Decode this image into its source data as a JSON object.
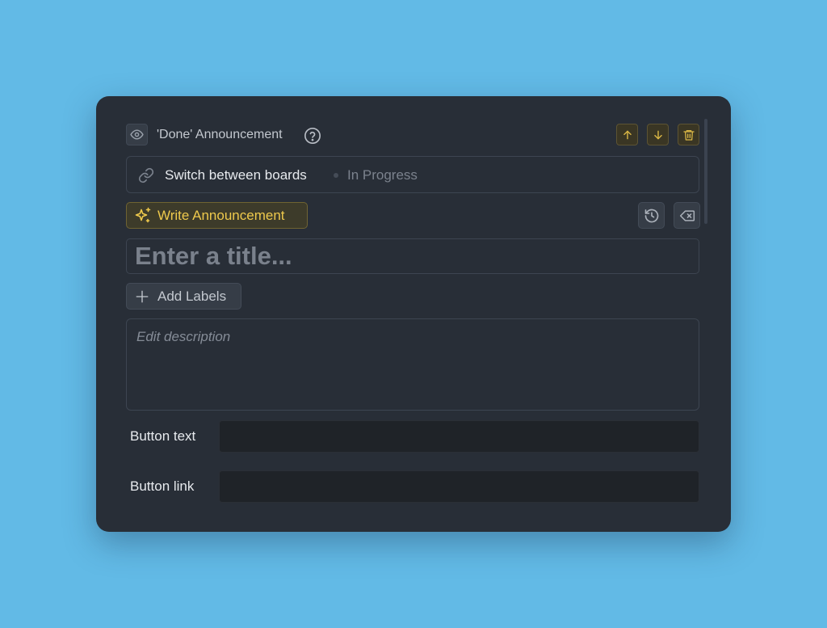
{
  "header": {
    "title": "'Done' Announcement",
    "icons": {
      "visibility": "eye-icon",
      "help": "question-circle-icon",
      "move_up": "arrow-up-icon",
      "move_down": "arrow-down-icon",
      "delete": "trash-icon"
    }
  },
  "linked_item": {
    "icon": "link-icon",
    "title": "Switch between boards",
    "status": "In Progress"
  },
  "toolbar": {
    "write_label": "Write Announcement",
    "write_icon": "sparkles-icon",
    "history_icon": "history-icon",
    "clear_icon": "backspace-icon"
  },
  "title_field": {
    "value": "",
    "placeholder": "Enter a title..."
  },
  "labels": {
    "add_label": "Add Labels"
  },
  "description": {
    "value": "",
    "placeholder": "Edit description"
  },
  "button_text": {
    "label": "Button text",
    "value": ""
  },
  "button_link": {
    "label": "Button link",
    "value": ""
  },
  "colors": {
    "background": "#62bae6",
    "card": "#282e37",
    "accent": "#eec94c",
    "input_dark": "#1f2328"
  }
}
